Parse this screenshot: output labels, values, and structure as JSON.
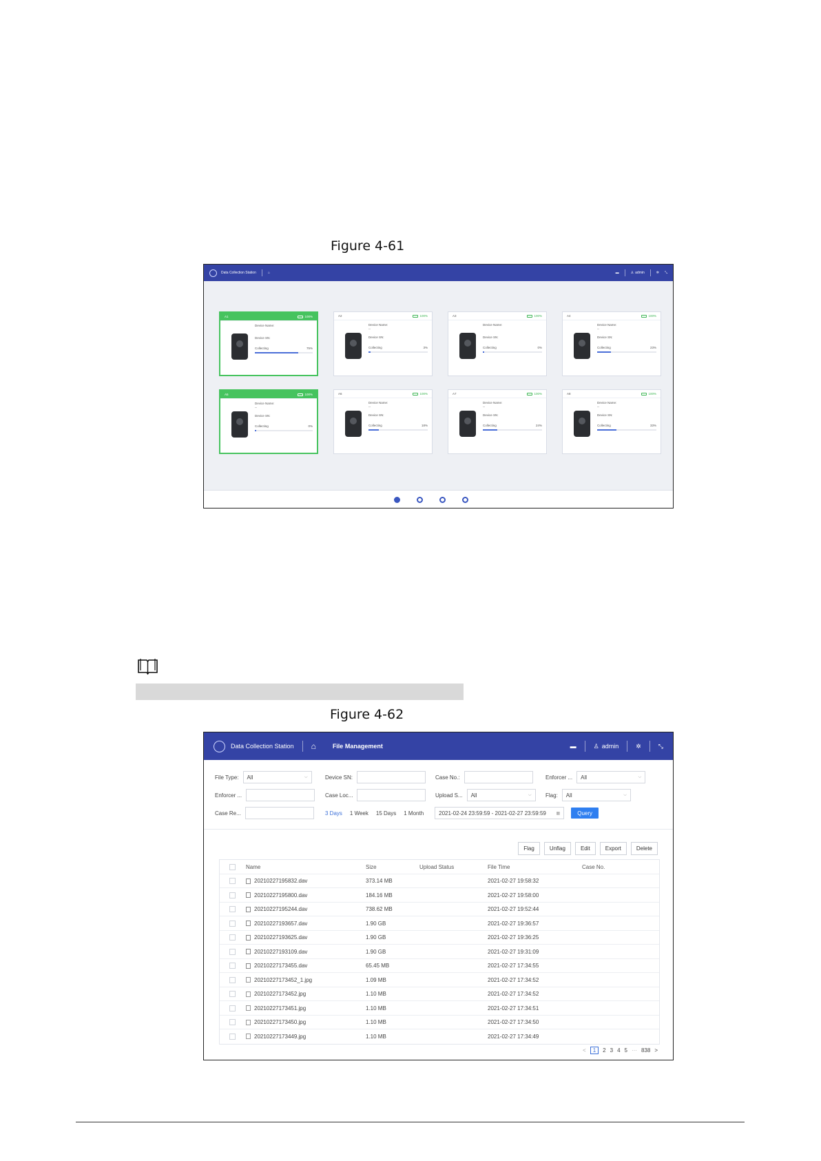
{
  "captions": {
    "fig1": "Figure 4-61",
    "fig2": "Figure 4-62"
  },
  "fig1": {
    "app_title": "Data Collection Station",
    "user": "admin",
    "icons": [
      "logo-icon",
      "home-icon",
      "folder-icon",
      "user-icon",
      "gear-icon",
      "fullscreen-icon",
      "battery-icon"
    ],
    "cards": [
      {
        "slot": "A1",
        "battery": "100%",
        "active": true,
        "name_label": "Device Name:",
        "name": "",
        "sn_label": "Device SN:",
        "sn": "",
        "status": "Collecting",
        "pct": "75%",
        "progress": 0.75,
        "stats": ""
      },
      {
        "slot": "A2",
        "battery": "100%",
        "active": false,
        "name_label": "Device Name:",
        "name": "--",
        "sn_label": "Device SN:",
        "sn": "",
        "status": "Collecting",
        "pct": "3%",
        "progress": 0.03,
        "stats": ""
      },
      {
        "slot": "A3",
        "battery": "100%",
        "active": false,
        "name_label": "Device Name:",
        "name": "",
        "sn_label": "Device SN:",
        "sn": "",
        "status": "Collecting",
        "pct": "0%",
        "progress": 0.0,
        "stats": ""
      },
      {
        "slot": "A4",
        "battery": "100%",
        "active": false,
        "name_label": "Device Name:",
        "name": "--",
        "sn_label": "Device SN:",
        "sn": "",
        "status": "Collecting",
        "pct": "23%",
        "progress": 0.23,
        "stats": ""
      },
      {
        "slot": "A5",
        "battery": "100%",
        "active": true,
        "name_label": "Device Name:",
        "name": "--",
        "sn_label": "Device SN:",
        "sn": "",
        "status": "Collecting",
        "pct": "0%",
        "progress": 0.0,
        "stats": ""
      },
      {
        "slot": "A6",
        "battery": "100%",
        "active": false,
        "name_label": "Device Name:",
        "name": "--",
        "sn_label": "Device SN:",
        "sn": "",
        "status": "Collecting",
        "pct": "18%",
        "progress": 0.18,
        "stats": ""
      },
      {
        "slot": "A7",
        "battery": "100%",
        "active": false,
        "name_label": "Device Name:",
        "name": "--",
        "sn_label": "Device SN:",
        "sn": "",
        "status": "Collecting",
        "pct": "24%",
        "progress": 0.24,
        "stats": ""
      },
      {
        "slot": "A8",
        "battery": "100%",
        "active": false,
        "name_label": "Device Name:",
        "name": "--",
        "sn_label": "Device SN:",
        "sn": "",
        "status": "Collecting",
        "pct": "33%",
        "progress": 0.33,
        "stats": ""
      }
    ],
    "pagination_dots": 4,
    "current_page_dot": 1
  },
  "fig2": {
    "app_title": "Data Collection Station",
    "page_title": "File Management",
    "user": "admin",
    "filters": {
      "file_type": {
        "label": "File Type:",
        "value": "All"
      },
      "device_sn": {
        "label": "Device SN:",
        "value": ""
      },
      "case_no": {
        "label": "Case No.:",
        "value": ""
      },
      "enforcer1": {
        "label": "Enforcer ...",
        "value": "All"
      },
      "enforcer2": {
        "label": "Enforcer ...",
        "value": ""
      },
      "case_loc": {
        "label": "Case Loc...",
        "value": ""
      },
      "upload_s": {
        "label": "Upload S...",
        "value": "All"
      },
      "flag": {
        "label": "Flag:",
        "value": "All"
      },
      "case_re": {
        "label": "Case Re...",
        "value": ""
      },
      "quick_ranges": [
        "3 Days",
        "1 Week",
        "15 Days",
        "1 Month"
      ],
      "selected_range": "3 Days",
      "date_range": "2021-02-24 23:59:59 - 2021-02-27 23:59:59",
      "query_label": "Query"
    },
    "actions": [
      "Flag",
      "Unflag",
      "Edit",
      "Export",
      "Delete"
    ],
    "columns": [
      "Name",
      "Size",
      "Upload Status",
      "File Time",
      "Case No."
    ],
    "rows": [
      {
        "name": "20210227195832.dav",
        "size": "373.14 MB",
        "upload": "",
        "time": "2021-02-27 19:58:32",
        "case": "",
        "kind": "video"
      },
      {
        "name": "20210227195800.dav",
        "size": "184.16 MB",
        "upload": "",
        "time": "2021-02-27 19:58:00",
        "case": "",
        "kind": "video"
      },
      {
        "name": "20210227195244.dav",
        "size": "738.62 MB",
        "upload": "",
        "time": "2021-02-27 19:52:44",
        "case": "",
        "kind": "video"
      },
      {
        "name": "20210227193657.dav",
        "size": "1.90 GB",
        "upload": "",
        "time": "2021-02-27 19:36:57",
        "case": "",
        "kind": "video"
      },
      {
        "name": "20210227193625.dav",
        "size": "1.90 GB",
        "upload": "",
        "time": "2021-02-27 19:36:25",
        "case": "",
        "kind": "video"
      },
      {
        "name": "20210227193109.dav",
        "size": "1.90 GB",
        "upload": "",
        "time": "2021-02-27 19:31:09",
        "case": "",
        "kind": "video"
      },
      {
        "name": "20210227173455.dav",
        "size": "65.45 MB",
        "upload": "",
        "time": "2021-02-27 17:34:55",
        "case": "",
        "kind": "video"
      },
      {
        "name": "20210227173452_1.jpg",
        "size": "1.09 MB",
        "upload": "",
        "time": "2021-02-27 17:34:52",
        "case": "",
        "kind": "image"
      },
      {
        "name": "20210227173452.jpg",
        "size": "1.10 MB",
        "upload": "",
        "time": "2021-02-27 17:34:52",
        "case": "",
        "kind": "image"
      },
      {
        "name": "20210227173451.jpg",
        "size": "1.10 MB",
        "upload": "",
        "time": "2021-02-27 17:34:51",
        "case": "",
        "kind": "image"
      },
      {
        "name": "20210227173450.jpg",
        "size": "1.10 MB",
        "upload": "",
        "time": "2021-02-27 17:34:50",
        "case": "",
        "kind": "image"
      },
      {
        "name": "20210227173449.jpg",
        "size": "1.10 MB",
        "upload": "",
        "time": "2021-02-27 17:34:49",
        "case": "",
        "kind": "image"
      }
    ],
    "pager": {
      "prev": "<",
      "pages": [
        "1",
        "2",
        "3",
        "4",
        "5"
      ],
      "ellipsis": "···",
      "last": "838",
      "next": ">",
      "current": "1"
    }
  },
  "colors": {
    "topbar": "#3443a5",
    "active_card": "#46c35e",
    "accent": "#2f7ff0",
    "progress": "#4a6ed8"
  }
}
